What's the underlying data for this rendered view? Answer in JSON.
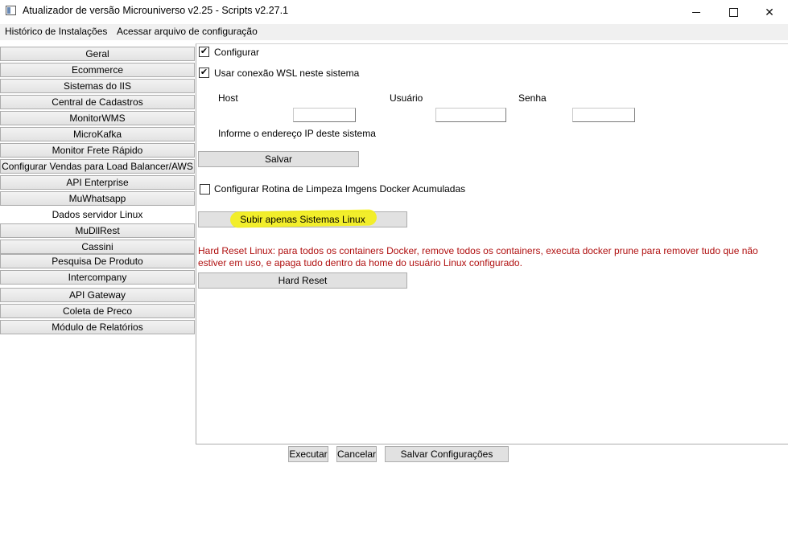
{
  "window": {
    "title": "Atualizador de versão Microuniverso v2.25 - Scripts v2.27.1",
    "controls": {
      "minimize": "–",
      "maximize": "□",
      "close": "✕"
    }
  },
  "menu": {
    "items": [
      "Histórico de Instalações",
      "Acessar arquivo de configuração"
    ]
  },
  "sidebar": {
    "selected": "Dados servidor Linux",
    "tabs": [
      "Geral",
      "Ecommerce",
      "Sistemas do IIS",
      "Central de Cadastros",
      "MonitorWMS",
      "MicroKafka",
      "Monitor Frete Rápido",
      "Configurar Vendas para Load Balancer/AWS",
      "API Enterprise",
      "MuWhatsapp",
      "Dados servidor Linux",
      "MuDllRest",
      "Cassini",
      "Pesquisa De Produto",
      "Intercompany",
      "API Gateway",
      "Coleta de Preco",
      "Módulo de Relatórios"
    ]
  },
  "linux": {
    "configurar": {
      "label": "Configurar",
      "checked": true
    },
    "usar_wsl": {
      "label": "Usar conexão WSL neste sistema",
      "checked": true
    },
    "host": {
      "label": "Host",
      "value": ""
    },
    "usuario": {
      "label": "Usuário",
      "value": ""
    },
    "senha": {
      "label": "Senha",
      "value": ""
    },
    "hint": "Informe o endereço IP deste sistema",
    "salvar": "Salvar",
    "limpeza": {
      "label": "Configurar Rotina de Limpeza Imgens Docker Acumuladas",
      "checked": false
    },
    "subir": "Subir apenas Sistemas Linux",
    "hard_reset_desc": "Hard Reset Linux: para todos os containers Docker, remove todos os containers, executa docker prune para remover tudo que não estiver em uso, e apaga tudo dentro da home do usuário Linux configurado.",
    "hard_reset": "Hard Reset"
  },
  "footer": {
    "executar": "Executar",
    "cancelar": "Cancelar",
    "salvar_config": "Salvar Configurações"
  },
  "colors": {
    "highlight": "#f4f00a",
    "warning_text": "#b01010"
  }
}
